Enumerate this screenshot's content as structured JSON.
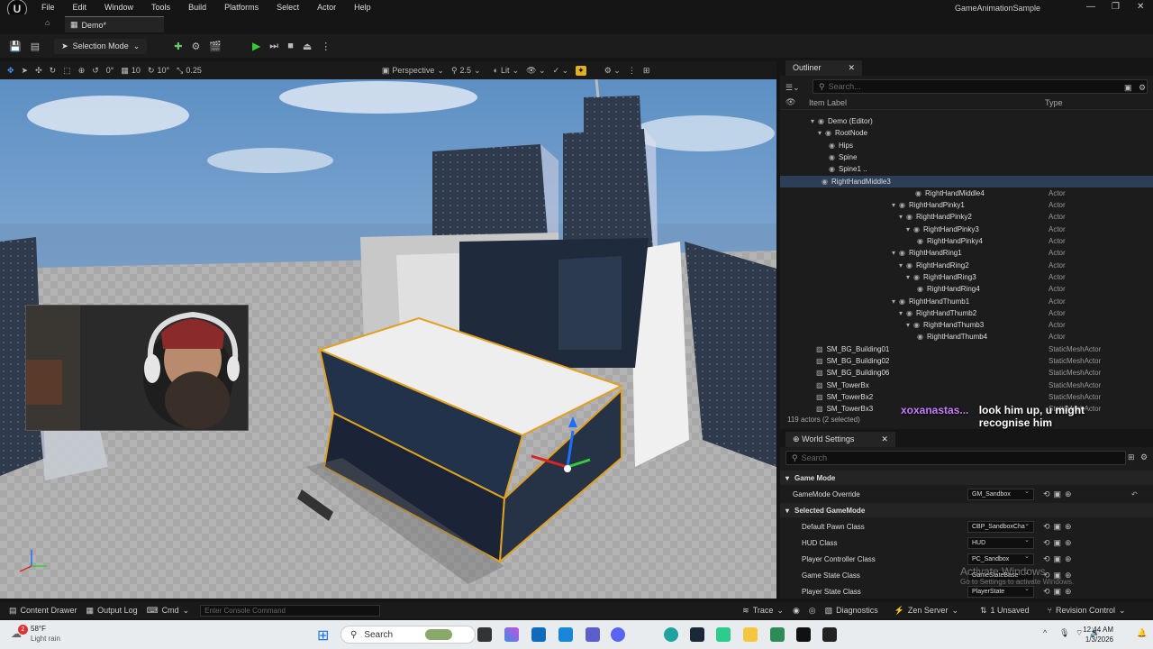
{
  "app": {
    "title": "GameAnimationSample",
    "doc_tab": "Demo*"
  },
  "menu": [
    "File",
    "Edit",
    "Window",
    "Tools",
    "Build",
    "Platforms",
    "Select",
    "Actor",
    "Help"
  ],
  "toolbar": {
    "selection_mode": "Selection Mode"
  },
  "viewport_toolbar": {
    "perspective": "Perspective",
    "speed": "2.5",
    "lit": "Lit",
    "grid_snap": "10",
    "rot_snap": "10°",
    "scale_snap": "0.25",
    "angle": "0°"
  },
  "outliner": {
    "title": "Outliner",
    "search_placeholder": "Search...",
    "col_label": "Item Label",
    "col_type": "Type",
    "rows": [
      {
        "label": "Demo (Editor)",
        "type": ""
      },
      {
        "label": "RootNode",
        "type": ""
      },
      {
        "label": "Hips",
        "type": ""
      },
      {
        "label": "Spine",
        "type": ""
      },
      {
        "label": "Spine1 ..",
        "type": ""
      },
      {
        "label": "RightHandMiddle3",
        "type": ""
      },
      {
        "label": "RightHandMiddle4",
        "type": "Actor"
      },
      {
        "label": "RightHandPinky1",
        "type": "Actor"
      },
      {
        "label": "RightHandPinky2",
        "type": "Actor"
      },
      {
        "label": "RightHandPinky3",
        "type": "Actor"
      },
      {
        "label": "RightHandPinky4",
        "type": "Actor"
      },
      {
        "label": "RightHandRing1",
        "type": "Actor"
      },
      {
        "label": "RightHandRing2",
        "type": "Actor"
      },
      {
        "label": "RightHandRing3",
        "type": "Actor"
      },
      {
        "label": "RightHandRing4",
        "type": "Actor"
      },
      {
        "label": "RightHandThumb1",
        "type": "Actor"
      },
      {
        "label": "RightHandThumb2",
        "type": "Actor"
      },
      {
        "label": "RightHandThumb3",
        "type": "Actor"
      },
      {
        "label": "RightHandThumb4",
        "type": "Actor"
      },
      {
        "label": "SM_BG_Building01",
        "type": "StaticMeshActor"
      },
      {
        "label": "SM_BG_Building02",
        "type": "StaticMeshActor"
      },
      {
        "label": "SM_BG_Building06",
        "type": "StaticMeshActor"
      },
      {
        "label": "SM_TowerBx",
        "type": "StaticMeshActor"
      },
      {
        "label": "SM_TowerBx2",
        "type": "StaticMeshActor"
      },
      {
        "label": "SM_TowerBx3",
        "type": "StaticMeshActor"
      }
    ],
    "actor_count": "119 actors (2 selected)"
  },
  "chat": {
    "user": "xoxanastas...",
    "message": "look him up, u might recognise him"
  },
  "world_settings": {
    "title": "World Settings",
    "search_placeholder": "Search",
    "section_game_mode": "Game Mode",
    "gamemode_override_label": "GameMode Override",
    "gamemode_override_value": "GM_Sandbox",
    "section_selected": "Selected GameMode",
    "props": [
      {
        "label": "Default Pawn Class",
        "value": "CBP_SandboxCha"
      },
      {
        "label": "HUD Class",
        "value": "HUD"
      },
      {
        "label": "Player Controller Class",
        "value": "PC_Sandbox"
      },
      {
        "label": "Game State Class",
        "value": "GameStateBase"
      },
      {
        "label": "Player State Class",
        "value": "PlayerState"
      }
    ]
  },
  "activate": {
    "line1": "Activate Windows",
    "line2": "Go to Settings to activate Windows."
  },
  "statusbar": {
    "content_drawer": "Content Drawer",
    "output_log": "Output Log",
    "cmd": "Cmd",
    "console_placeholder": "Enter Console Command",
    "trace": "Trace",
    "diagnostics": "Diagnostics",
    "zen_server": "Zen Server",
    "unsaved": "1 Unsaved",
    "revision_control": "Revision Control"
  },
  "taskbar": {
    "weather_temp": "58°F",
    "weather_desc": "Light rain",
    "weather_badge": "2",
    "search": "Search",
    "time": "12:44 AM",
    "date": "1/3/2026"
  },
  "colors": {
    "accent": "#2c3f57",
    "selection_outline": "#e0a020",
    "chat_user": "#c87cff"
  }
}
